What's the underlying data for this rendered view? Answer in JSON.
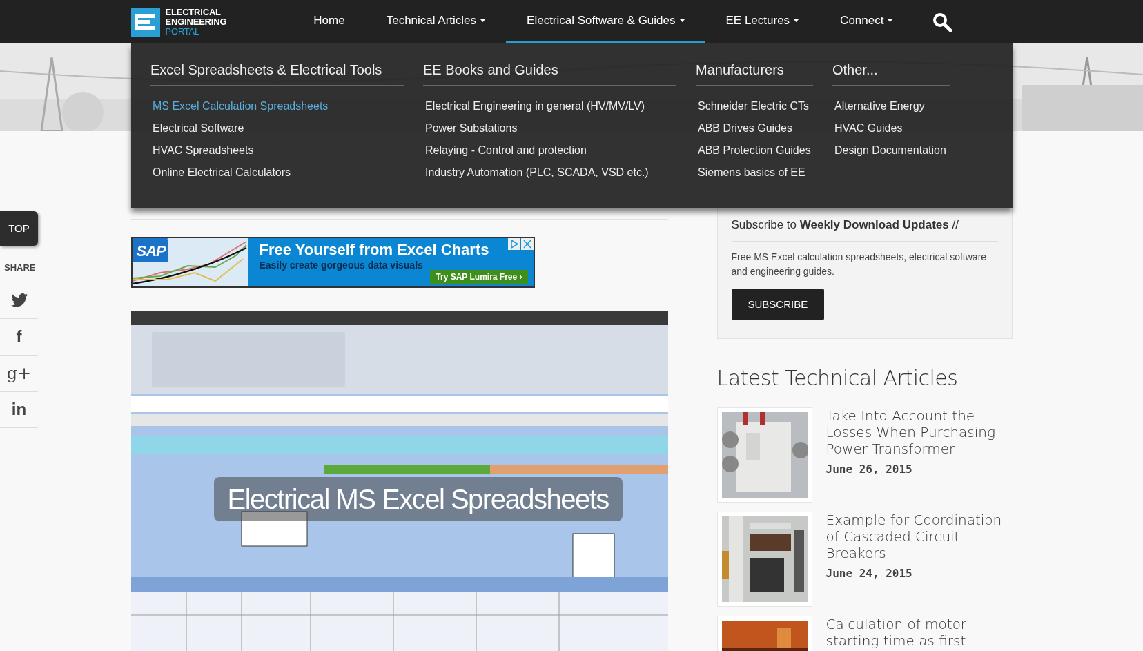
{
  "logo": {
    "line1": "ELECTRICAL",
    "line2": "ENGINEERING",
    "line3": "PORTAL"
  },
  "nav": [
    {
      "label": "Home",
      "has_menu": false,
      "selected": false
    },
    {
      "label": "Technical Articles",
      "has_menu": true,
      "selected": false
    },
    {
      "label": "Electrical Software & Guides",
      "has_menu": true,
      "selected": true
    },
    {
      "label": "EE Lectures",
      "has_menu": true,
      "selected": false
    },
    {
      "label": "Connect",
      "has_menu": true,
      "selected": false
    }
  ],
  "mega_menu": [
    {
      "heading": "Excel Spreadsheets & Electrical Tools",
      "items": [
        {
          "label": "MS Excel Calculation Spreadsheets",
          "selected": true
        },
        {
          "label": "Electrical Software",
          "selected": false
        },
        {
          "label": "HVAC Spreadsheets",
          "selected": false
        },
        {
          "label": "Online Electrical Calculators",
          "selected": false
        }
      ]
    },
    {
      "heading": "EE Books and Guides",
      "items": [
        {
          "label": "Electrical Engineering in general (HV/MV/LV)",
          "selected": false
        },
        {
          "label": "Power Substations",
          "selected": false
        },
        {
          "label": "Relaying - Control and protection",
          "selected": false
        },
        {
          "label": "Industry Automation (PLC, SCADA, VSD etc.)",
          "selected": false
        }
      ]
    },
    {
      "heading": "Manufacturers",
      "items": [
        {
          "label": "Schneider Electric CTs",
          "selected": false
        },
        {
          "label": "ABB Drives Guides",
          "selected": false
        },
        {
          "label": "ABB Protection Guides",
          "selected": false
        },
        {
          "label": "Siemens basics of EE",
          "selected": false
        }
      ]
    },
    {
      "heading": "Other...",
      "items": [
        {
          "label": "Alternative Energy",
          "selected": false
        },
        {
          "label": "HVAC Guides",
          "selected": false
        },
        {
          "label": "Design Documentation",
          "selected": false
        }
      ]
    }
  ],
  "top_button": "TOP",
  "share": {
    "label": "SHARE",
    "items": [
      {
        "kind": "bird"
      },
      {
        "kind": "glyph",
        "glyph": "f"
      },
      {
        "kind": "glyph",
        "glyph": "g+"
      },
      {
        "kind": "glyph",
        "glyph": "in"
      }
    ]
  },
  "ad": {
    "logo": "SAP",
    "headline": "Free Yourself from Excel Charts",
    "subline": "Easily create gorgeous data visuals",
    "cta": "Try SAP Lumira Free",
    "cta_arrow": "›"
  },
  "featured_image": {
    "kind": "picture",
    "caption": "Electrical MS Excel Spreadsheets"
  },
  "subscribe": {
    "title": "Subscribe to **Weekly Download Updates** //",
    "text": "Free MS Excel calculation spreadsheets, electrical software and engineering guides.",
    "button": "SUBSCRIBE"
  },
  "latest": {
    "heading": "Latest Technical Articles",
    "articles": [
      {
        "kind": "transformer",
        "title": "Take Into Account the Losses When Purchasing Power Transformer",
        "date": "June 26, 2015"
      },
      {
        "kind": "panel",
        "title": "Example for Coordination of Cascaded Circuit Breakers",
        "date": "June 24, 2015"
      },
      {
        "kind": "motor",
        "title": "Calculation of motor starting time as first"
      }
    ]
  }
}
